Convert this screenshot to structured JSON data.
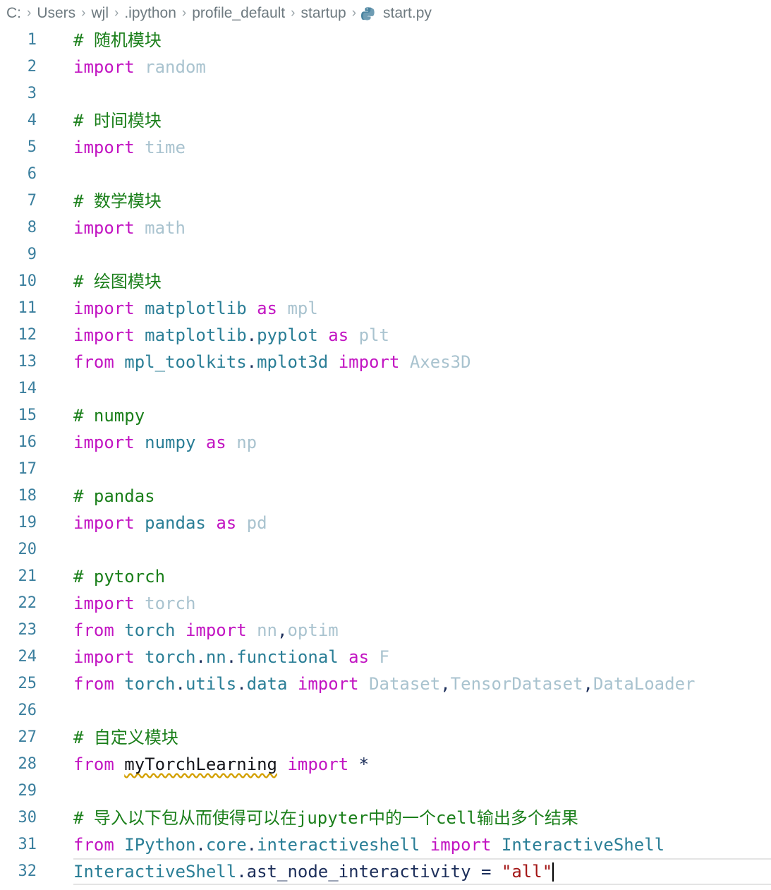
{
  "breadcrumb": {
    "segments": [
      "C:",
      "Users",
      "wjl",
      ".ipython",
      "profile_default",
      "startup"
    ],
    "separator": "›",
    "file_name": "start.py",
    "file_icon": "python-icon"
  },
  "editor": {
    "language": "Python",
    "active_line": 32,
    "cursor_after": "\"all\"",
    "colors": {
      "comment": "#1a7f1a",
      "keyword": "#c214c2",
      "module": "#2a7e96",
      "alias": "#a9c3cf",
      "string": "#a31515",
      "identifier": "#1c2e5a",
      "line_number": "#3b7f9e",
      "warning_squiggle": "#d3a000",
      "active_line_border": "#e4e4e4",
      "background": "#ffffff"
    },
    "lines": [
      {
        "n": "1",
        "tokens": [
          {
            "t": "# ",
            "c": "comment"
          },
          {
            "t": "随机模块",
            "c": "comment"
          }
        ]
      },
      {
        "n": "2",
        "tokens": [
          {
            "t": "import",
            "c": "keyword"
          },
          {
            "t": " ",
            "c": "plain"
          },
          {
            "t": "random",
            "c": "alias"
          }
        ]
      },
      {
        "n": "3",
        "tokens": []
      },
      {
        "n": "4",
        "tokens": [
          {
            "t": "# ",
            "c": "comment"
          },
          {
            "t": "时间模块",
            "c": "comment"
          }
        ]
      },
      {
        "n": "5",
        "tokens": [
          {
            "t": "import",
            "c": "keyword"
          },
          {
            "t": " ",
            "c": "plain"
          },
          {
            "t": "time",
            "c": "alias"
          }
        ]
      },
      {
        "n": "6",
        "tokens": []
      },
      {
        "n": "7",
        "tokens": [
          {
            "t": "# ",
            "c": "comment"
          },
          {
            "t": "数学模块",
            "c": "comment"
          }
        ]
      },
      {
        "n": "8",
        "tokens": [
          {
            "t": "import",
            "c": "keyword"
          },
          {
            "t": " ",
            "c": "plain"
          },
          {
            "t": "math",
            "c": "alias"
          }
        ]
      },
      {
        "n": "9",
        "tokens": []
      },
      {
        "n": "10",
        "tokens": [
          {
            "t": "# ",
            "c": "comment"
          },
          {
            "t": "绘图模块",
            "c": "comment"
          }
        ]
      },
      {
        "n": "11",
        "tokens": [
          {
            "t": "import",
            "c": "keyword"
          },
          {
            "t": " ",
            "c": "plain"
          },
          {
            "t": "matplotlib",
            "c": "module"
          },
          {
            "t": " ",
            "c": "plain"
          },
          {
            "t": "as",
            "c": "keyword"
          },
          {
            "t": " ",
            "c": "plain"
          },
          {
            "t": "mpl",
            "c": "alias"
          }
        ]
      },
      {
        "n": "12",
        "tokens": [
          {
            "t": "import",
            "c": "keyword"
          },
          {
            "t": " ",
            "c": "plain"
          },
          {
            "t": "matplotlib",
            "c": "module"
          },
          {
            "t": ".",
            "c": "op"
          },
          {
            "t": "pyplot",
            "c": "module"
          },
          {
            "t": " ",
            "c": "plain"
          },
          {
            "t": "as",
            "c": "keyword"
          },
          {
            "t": " ",
            "c": "plain"
          },
          {
            "t": "plt",
            "c": "alias"
          }
        ]
      },
      {
        "n": "13",
        "tokens": [
          {
            "t": "from",
            "c": "keyword"
          },
          {
            "t": " ",
            "c": "plain"
          },
          {
            "t": "mpl_toolkits",
            "c": "module"
          },
          {
            "t": ".",
            "c": "op"
          },
          {
            "t": "mplot3d",
            "c": "module"
          },
          {
            "t": " ",
            "c": "plain"
          },
          {
            "t": "import",
            "c": "keyword"
          },
          {
            "t": " ",
            "c": "plain"
          },
          {
            "t": "Axes3D",
            "c": "alias"
          }
        ]
      },
      {
        "n": "14",
        "tokens": []
      },
      {
        "n": "15",
        "tokens": [
          {
            "t": "# numpy",
            "c": "comment"
          }
        ]
      },
      {
        "n": "16",
        "tokens": [
          {
            "t": "import",
            "c": "keyword"
          },
          {
            "t": " ",
            "c": "plain"
          },
          {
            "t": "numpy",
            "c": "module"
          },
          {
            "t": " ",
            "c": "plain"
          },
          {
            "t": "as",
            "c": "keyword"
          },
          {
            "t": " ",
            "c": "plain"
          },
          {
            "t": "np",
            "c": "alias"
          }
        ]
      },
      {
        "n": "17",
        "tokens": []
      },
      {
        "n": "18",
        "tokens": [
          {
            "t": "# pandas",
            "c": "comment"
          }
        ]
      },
      {
        "n": "19",
        "tokens": [
          {
            "t": "import",
            "c": "keyword"
          },
          {
            "t": " ",
            "c": "plain"
          },
          {
            "t": "pandas",
            "c": "module"
          },
          {
            "t": " ",
            "c": "plain"
          },
          {
            "t": "as",
            "c": "keyword"
          },
          {
            "t": " ",
            "c": "plain"
          },
          {
            "t": "pd",
            "c": "alias"
          }
        ]
      },
      {
        "n": "20",
        "tokens": []
      },
      {
        "n": "21",
        "tokens": [
          {
            "t": "# pytorch",
            "c": "comment"
          }
        ]
      },
      {
        "n": "22",
        "tokens": [
          {
            "t": "import",
            "c": "keyword"
          },
          {
            "t": " ",
            "c": "plain"
          },
          {
            "t": "torch",
            "c": "alias"
          }
        ]
      },
      {
        "n": "23",
        "tokens": [
          {
            "t": "from",
            "c": "keyword"
          },
          {
            "t": " ",
            "c": "plain"
          },
          {
            "t": "torch",
            "c": "module"
          },
          {
            "t": " ",
            "c": "plain"
          },
          {
            "t": "import",
            "c": "keyword"
          },
          {
            "t": " ",
            "c": "plain"
          },
          {
            "t": "nn",
            "c": "alias"
          },
          {
            "t": ",",
            "c": "op"
          },
          {
            "t": "optim",
            "c": "alias"
          }
        ]
      },
      {
        "n": "24",
        "tokens": [
          {
            "t": "import",
            "c": "keyword"
          },
          {
            "t": " ",
            "c": "plain"
          },
          {
            "t": "torch",
            "c": "module"
          },
          {
            "t": ".",
            "c": "op"
          },
          {
            "t": "nn",
            "c": "module"
          },
          {
            "t": ".",
            "c": "op"
          },
          {
            "t": "functional",
            "c": "module"
          },
          {
            "t": " ",
            "c": "plain"
          },
          {
            "t": "as",
            "c": "keyword"
          },
          {
            "t": " ",
            "c": "plain"
          },
          {
            "t": "F",
            "c": "alias"
          }
        ]
      },
      {
        "n": "25",
        "tokens": [
          {
            "t": "from",
            "c": "keyword"
          },
          {
            "t": " ",
            "c": "plain"
          },
          {
            "t": "torch",
            "c": "module"
          },
          {
            "t": ".",
            "c": "op"
          },
          {
            "t": "utils",
            "c": "module"
          },
          {
            "t": ".",
            "c": "op"
          },
          {
            "t": "data",
            "c": "module"
          },
          {
            "t": " ",
            "c": "plain"
          },
          {
            "t": "import",
            "c": "keyword"
          },
          {
            "t": " ",
            "c": "plain"
          },
          {
            "t": "Dataset",
            "c": "alias"
          },
          {
            "t": ",",
            "c": "op"
          },
          {
            "t": "TensorDataset",
            "c": "alias"
          },
          {
            "t": ",",
            "c": "op"
          },
          {
            "t": "DataLoader",
            "c": "alias"
          }
        ]
      },
      {
        "n": "26",
        "tokens": []
      },
      {
        "n": "27",
        "tokens": [
          {
            "t": "# ",
            "c": "comment"
          },
          {
            "t": "自定义模块",
            "c": "comment"
          }
        ]
      },
      {
        "n": "28",
        "tokens": [
          {
            "t": "from",
            "c": "keyword"
          },
          {
            "t": " ",
            "c": "plain"
          },
          {
            "t": "myTorchLearning",
            "c": "warn"
          },
          {
            "t": " ",
            "c": "plain"
          },
          {
            "t": "import",
            "c": "keyword"
          },
          {
            "t": " ",
            "c": "plain"
          },
          {
            "t": "*",
            "c": "op"
          }
        ]
      },
      {
        "n": "29",
        "tokens": []
      },
      {
        "n": "30",
        "tokens": [
          {
            "t": "# ",
            "c": "comment"
          },
          {
            "t": "导入以下包从而使得可以在jupyter中的一个cell输出多个结果",
            "c": "comment"
          }
        ]
      },
      {
        "n": "31",
        "tokens": [
          {
            "t": "from",
            "c": "keyword"
          },
          {
            "t": " ",
            "c": "plain"
          },
          {
            "t": "IPython",
            "c": "module"
          },
          {
            "t": ".",
            "c": "op"
          },
          {
            "t": "core",
            "c": "module"
          },
          {
            "t": ".",
            "c": "op"
          },
          {
            "t": "interactiveshell",
            "c": "module"
          },
          {
            "t": " ",
            "c": "plain"
          },
          {
            "t": "import",
            "c": "keyword"
          },
          {
            "t": " ",
            "c": "plain"
          },
          {
            "t": "InteractiveShell",
            "c": "class"
          }
        ]
      },
      {
        "n": "32",
        "active": true,
        "caret": true,
        "tokens": [
          {
            "t": "InteractiveShell",
            "c": "class"
          },
          {
            "t": ".",
            "c": "op"
          },
          {
            "t": "ast_node_interactivity",
            "c": "ident"
          },
          {
            "t": " ",
            "c": "plain"
          },
          {
            "t": "=",
            "c": "op"
          },
          {
            "t": " ",
            "c": "plain"
          },
          {
            "t": "\"all\"",
            "c": "string"
          }
        ]
      }
    ]
  }
}
